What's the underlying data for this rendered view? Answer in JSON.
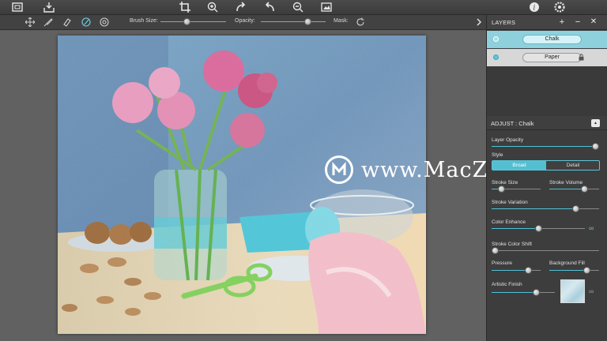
{
  "toolbar": {
    "icons": [
      "fit-to-screen-icon",
      "save-icon",
      "crop-icon",
      "zoom-in-icon",
      "undo-icon",
      "redo-icon",
      "zoom-out-icon",
      "image-icon",
      "info-icon",
      "settings-icon"
    ]
  },
  "options": {
    "brush_size_label": "Brush Size:",
    "opacity_label": "Opacity:",
    "mask_label": "Mask:",
    "brush_size_value": 0.4,
    "opacity_value": 0.72,
    "tools": [
      "move-tool-icon",
      "brush-tool-icon",
      "eraser-tool-icon",
      "smudge-tool-icon",
      "mask-tool-icon"
    ]
  },
  "layers": {
    "title": "LAYERS",
    "items": [
      {
        "name": "Chalk",
        "selected": true
      },
      {
        "name": "Paper",
        "selected": false,
        "locked": true
      }
    ]
  },
  "adjust": {
    "title": "ADJUST : Chalk",
    "layer_opacity_label": "Layer Opacity",
    "layer_opacity_value": 0.98,
    "style_label": "Style",
    "style_options": [
      "Broad",
      "Detail"
    ],
    "style_selected": "Broad",
    "stroke_size_label": "Stroke Size",
    "stroke_size_value": 0.2,
    "stroke_volume_label": "Stroke Volume",
    "stroke_volume_value": 0.7,
    "stroke_variation_label": "Stroke Variation",
    "stroke_variation_value": 0.78,
    "color_enhance_label": "Color Enhance",
    "color_enhance_value": 0.5,
    "stroke_color_shift_label": "Stroke Color Shift",
    "stroke_color_shift_value": 0.0,
    "pressure_label": "Pressure",
    "pressure_value": 0.75,
    "background_fill_label": "Background Fill",
    "background_fill_value": 0.75,
    "artistic_finish_label": "Artistic Finish",
    "artistic_finish_value": 0.7
  },
  "watermark": {
    "text": "www.MacZ.com"
  },
  "colors": {
    "accent": "#52bfd3",
    "panel_bg": "#3d3d3d",
    "selected_layer": "#8ed0dc"
  }
}
